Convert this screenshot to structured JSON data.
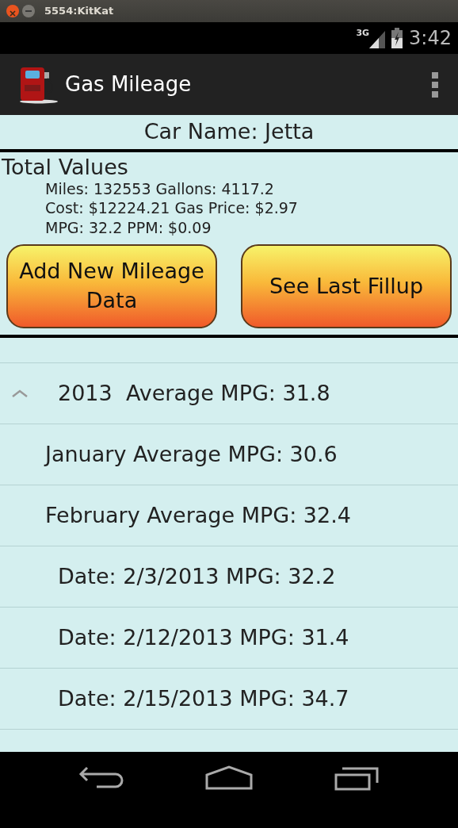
{
  "window": {
    "title": "5554:KitKat"
  },
  "status_bar": {
    "network": "3G",
    "time": "3:42"
  },
  "action_bar": {
    "title": "Gas Mileage"
  },
  "car_name": "Car Name: Jetta",
  "totals": {
    "heading": "Total Values",
    "lines": [
      "Miles: 132553 Gallons: 4117.2",
      "Cost: $12224.21 Gas Price: $2.97",
      "MPG: 32.2 PPM: $0.09"
    ]
  },
  "buttons": [
    "Add New Mileage Data",
    "See Last Fillup"
  ],
  "years": [
    {
      "label": "2013  Average MPG: 31.8",
      "expanded": true,
      "children": [
        {
          "label": "January Average MPG: 30.6"
        },
        {
          "label": "February Average MPG: 32.4",
          "children": [
            {
              "label": "Date: 2/3/2013 MPG: 32.2"
            },
            {
              "label": "Date: 2/12/2013 MPG: 31.4"
            },
            {
              "label": "Date: 2/15/2013 MPG: 34.7"
            }
          ]
        }
      ]
    }
  ]
}
